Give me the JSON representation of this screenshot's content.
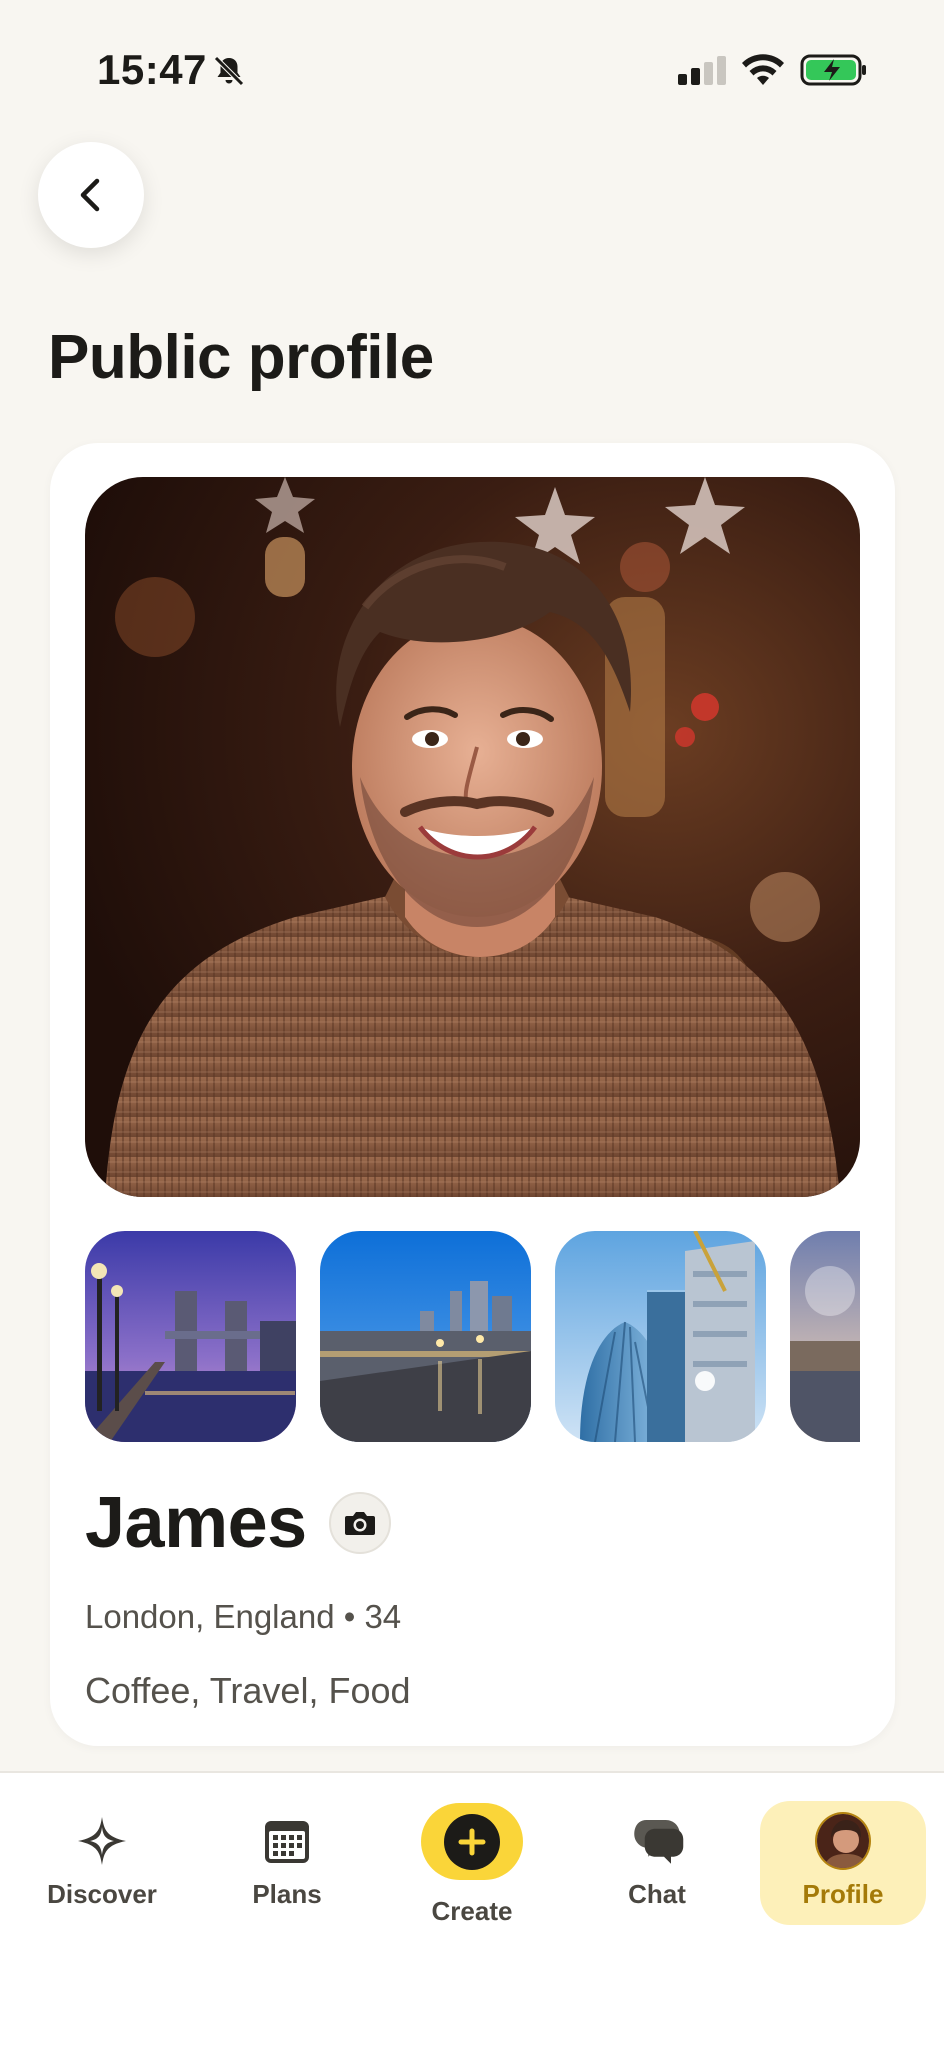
{
  "status_bar": {
    "time": "15:47",
    "icons": [
      "bell-slash-icon",
      "cellular-signal-icon",
      "wifi-icon",
      "battery-charging-icon"
    ]
  },
  "nav": {
    "back_icon": "chevron-left-icon"
  },
  "page": {
    "title": "Public profile"
  },
  "profile": {
    "name": "James",
    "camera_icon": "camera-icon",
    "meta": "London, England • 34",
    "interests": "Coffee, Travel, Food",
    "gallery_count_visible": 4
  },
  "tabbar": {
    "items": [
      {
        "label": "Discover",
        "icon": "sparkle-icon"
      },
      {
        "label": "Plans",
        "icon": "calendar-icon"
      },
      {
        "label": "Create",
        "icon": "plus-circle-icon"
      },
      {
        "label": "Chat",
        "icon": "chat-bubbles-icon"
      },
      {
        "label": "Profile",
        "icon": "avatar"
      }
    ],
    "active": "Profile"
  },
  "colors": {
    "background": "#f8f6f1",
    "accent_yellow": "#fad539",
    "active_tab_bg": "#fdf0b9",
    "active_tab_text": "#a47a08"
  }
}
